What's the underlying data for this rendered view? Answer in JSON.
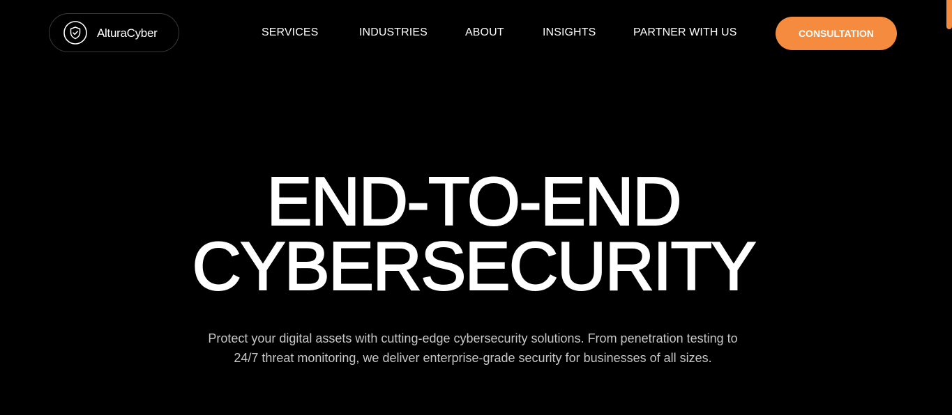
{
  "header": {
    "logo_text": "AlturaCyber",
    "logo_icon": "shield-check-icon",
    "nav": [
      {
        "label": "SERVICES"
      },
      {
        "label": "INDUSTRIES"
      },
      {
        "label": "ABOUT"
      },
      {
        "label": "INSIGHTS"
      },
      {
        "label": "PARTNER WITH US"
      }
    ],
    "cta_label": "CONSULTATION"
  },
  "hero": {
    "title_line_1": "END-TO-END",
    "title_line_2": "CYBERSECURITY",
    "subtitle": "Protect your digital assets with cutting-edge cybersecurity solutions. From penetration testing to 24/7 threat monitoring, we deliver enterprise-grade security for businesses of all sizes."
  },
  "colors": {
    "background": "#000000",
    "accent": "#f48b3e",
    "text": "#ffffff",
    "muted_text": "#c7c7c7"
  }
}
